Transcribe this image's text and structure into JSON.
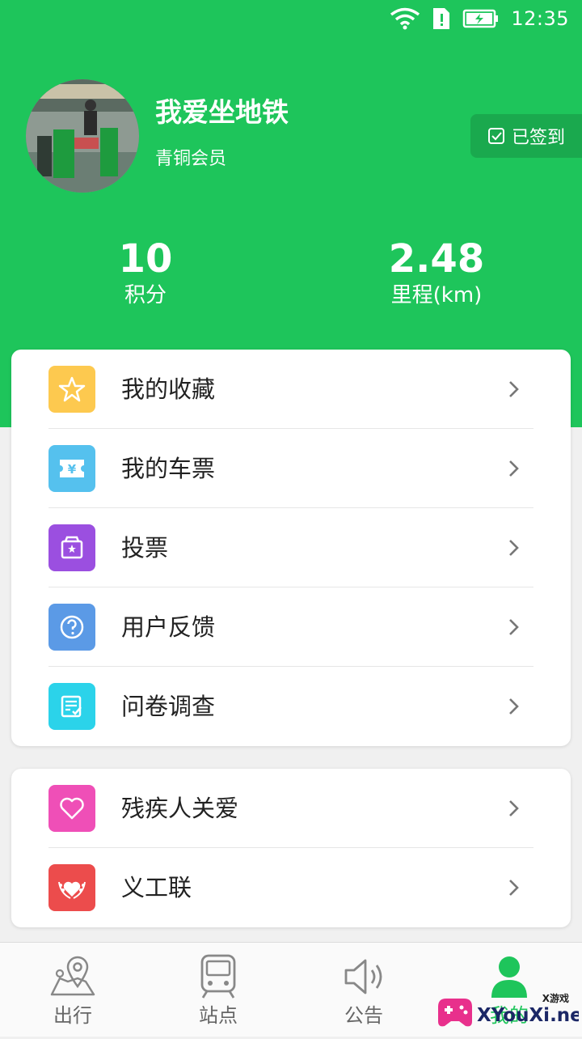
{
  "status_bar": {
    "time": "12:35"
  },
  "profile": {
    "name": "我爱坐地铁",
    "level": "青铜会员",
    "checkin_label": "已签到"
  },
  "stats": {
    "points": {
      "value": "10",
      "label": "积分"
    },
    "mileage": {
      "value": "2.48",
      "label": "里程(km)"
    }
  },
  "menu_group_1": [
    {
      "label": "我的收藏",
      "icon": "star-icon",
      "color": "#fdc94f"
    },
    {
      "label": "我的车票",
      "icon": "ticket-icon",
      "color": "#55c1ee"
    },
    {
      "label": "投票",
      "icon": "vote-box-icon",
      "color": "#9b4fe0"
    },
    {
      "label": "用户反馈",
      "icon": "question-icon",
      "color": "#5b9ae6"
    },
    {
      "label": "问卷调查",
      "icon": "survey-icon",
      "color": "#2bd3ea"
    }
  ],
  "menu_group_2": [
    {
      "label": "残疾人关爱",
      "icon": "heart-icon",
      "color": "#ef4fb7"
    },
    {
      "label": "义工联",
      "icon": "volunteer-emblem-icon",
      "color": "#ec4c4c"
    }
  ],
  "tabs": [
    {
      "label": "出行",
      "icon": "map-pin-icon"
    },
    {
      "label": "站点",
      "icon": "train-icon"
    },
    {
      "label": "公告",
      "icon": "speaker-icon"
    },
    {
      "label": "我的",
      "icon": "user-icon",
      "active": true
    }
  ],
  "colors": {
    "brand_green": "#1ec55b",
    "checkin_bg": "#1aa94e"
  },
  "watermark": {
    "small": "X游戏",
    "main": "XYouXi.net"
  }
}
